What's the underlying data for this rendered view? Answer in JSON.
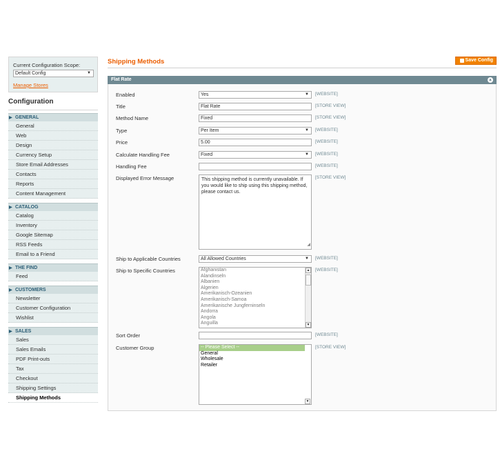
{
  "sidebar": {
    "scope_label": "Current Configuration Scope:",
    "scope_value": "Default Config",
    "manage_stores": "Manage Stores",
    "title": "Configuration",
    "sections": [
      {
        "name": "GENERAL",
        "items": [
          "General",
          "Web",
          "Design",
          "Currency Setup",
          "Store Email Addresses",
          "Contacts",
          "Reports",
          "Content Management"
        ]
      },
      {
        "name": "CATALOG",
        "items": [
          "Catalog",
          "Inventory",
          "Google Sitemap",
          "RSS Feeds",
          "Email to a Friend"
        ]
      },
      {
        "name": "THE FIND",
        "items": [
          "Feed"
        ]
      },
      {
        "name": "CUSTOMERS",
        "items": [
          "Newsletter",
          "Customer Configuration",
          "Wishlist"
        ]
      },
      {
        "name": "SALES",
        "items": [
          "Sales",
          "Sales Emails",
          "PDF Print-outs",
          "Tax",
          "Checkout",
          "Shipping Settings",
          "Shipping Methods"
        ]
      }
    ]
  },
  "header": {
    "title": "Shipping Methods",
    "save_label": "Save Config"
  },
  "fieldset": {
    "title": "Flat Rate",
    "rows": {
      "enabled": {
        "label": "Enabled",
        "value": "Yes",
        "scope": "[WEBSITE]"
      },
      "title": {
        "label": "Title",
        "value": "Flat Rate",
        "scope": "[STORE VIEW]"
      },
      "method_name": {
        "label": "Method Name",
        "value": "Fixed",
        "scope": "[STORE VIEW]"
      },
      "type": {
        "label": "Type",
        "value": "Per Item",
        "scope": "[WEBSITE]"
      },
      "price": {
        "label": "Price",
        "value": "5.00",
        "scope": "[WEBSITE]"
      },
      "handling_calc": {
        "label": "Calculate Handling Fee",
        "value": "Fixed",
        "scope": "[WEBSITE]"
      },
      "handling_fee": {
        "label": "Handling Fee",
        "value": "",
        "scope": "[WEBSITE]"
      },
      "error_msg": {
        "label": "Displayed Error Message",
        "value": "This shipping method is currently unavailable. If you would like to ship using this shipping method, please contact us.",
        "scope": "[STORE VIEW]"
      },
      "applicable_countries": {
        "label": "Ship to Applicable Countries",
        "value": "All Allowed Countries",
        "scope": "[WEBSITE]"
      },
      "specific_countries": {
        "label": "Ship to Specific Countries",
        "scope": "[WEBSITE]",
        "options": [
          "Afghanistan",
          "Alandinseln",
          "Albanien",
          "Algerien",
          "Amerikanisch-Ozeanien",
          "Amerikanisch-Samoa",
          "Amerikanische Jungferninseln",
          "Andorra",
          "Angola",
          "Anguilla"
        ]
      },
      "sort_order": {
        "label": "Sort Order",
        "value": "",
        "scope": "[WEBSITE]"
      },
      "customer_group": {
        "label": "Customer Group",
        "scope": "[STORE VIEW]",
        "options": [
          "-- Please Select --",
          "General",
          "Wholesale",
          "Retailer"
        ]
      }
    }
  },
  "colors": {
    "accent": "#eb5e00",
    "save_button": "#f18200",
    "fieldset_header": "#6f8992",
    "section_head": "#d1dedf",
    "selected_option": "#a8cf8a"
  },
  "icons": {
    "collapse": "collapse-icon",
    "save": "save-icon",
    "dropdown": "chevron-down-icon"
  }
}
